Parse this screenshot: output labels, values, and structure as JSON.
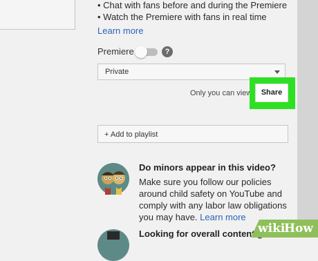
{
  "premiere_info": {
    "bullets": [
      "• Chat with fans before and during the Premiere",
      "• Watch the Premiere with fans in real time"
    ],
    "learn_more": "Learn more"
  },
  "premiere": {
    "label": "Premiere",
    "toggle_on": false,
    "help_icon": "?"
  },
  "visibility": {
    "selected": "Private",
    "caption": "Only you can view",
    "share_label": "Share"
  },
  "playlist": {
    "button_label": "+ Add to playlist"
  },
  "minors": {
    "title": "Do minors appear in this video?",
    "lines": [
      "Make sure you follow our policies",
      "around child safety on YouTube and",
      "comply with any labor law obligations"
    ],
    "last_line_text": "you may have.",
    "learn_more": "Learn more"
  },
  "content_guidance": {
    "title": "Looking for overall content guidance?"
  },
  "watermark": {
    "part1": "wiki",
    "part2": "How"
  },
  "colors": {
    "highlight": "#2ee023",
    "link": "#2b63b6",
    "watermark_bg": "#8fbf5a"
  }
}
